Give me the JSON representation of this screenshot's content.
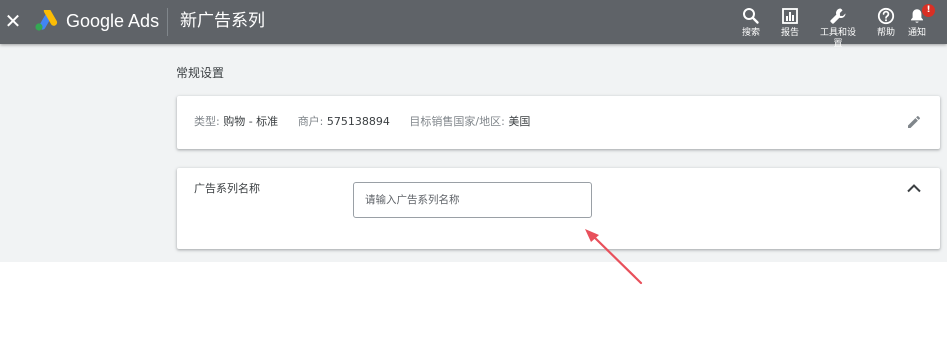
{
  "header": {
    "close_icon": "close-icon",
    "brand": "Google Ads",
    "title": "新广告系列",
    "tools": [
      {
        "icon": "search-icon",
        "label": "搜索"
      },
      {
        "icon": "reports-icon",
        "label": "报告"
      },
      {
        "icon": "wrench-icon",
        "label": "工具和设置"
      },
      {
        "icon": "help-icon",
        "label": "帮助"
      },
      {
        "icon": "bell-icon",
        "label": "通知"
      }
    ],
    "notification_badge": "!"
  },
  "main": {
    "section_title": "常规设置",
    "summary": {
      "type_key": "类型:",
      "type_value": "购物 - 标准",
      "merchant_key": "商户:",
      "merchant_value": "575138894",
      "country_key": "目标销售国家/地区:",
      "country_value": "美国"
    },
    "name_card": {
      "label": "广告系列名称",
      "input_value": "",
      "placeholder": "请输入广告系列名称"
    }
  },
  "colors": {
    "topbar": "#5f6368",
    "page_background": "#f1f3f4",
    "badge": "#d93025",
    "annotation_arrow": "#e8505b"
  }
}
